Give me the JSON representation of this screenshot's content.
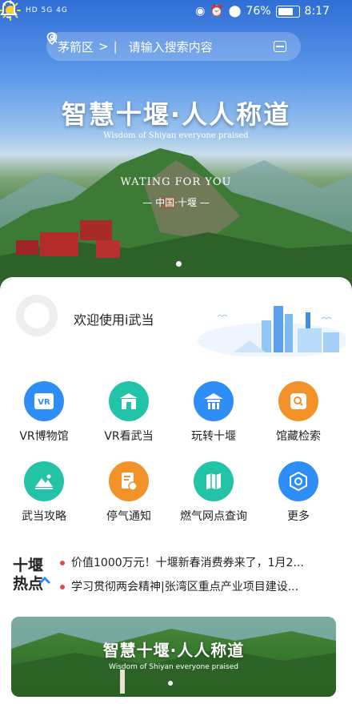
{
  "status": {
    "left": "HD 5G 4G",
    "battery": "76%",
    "time": "8:17"
  },
  "search": {
    "district": "茅箭区",
    "chevron": ">",
    "separator": "|",
    "placeholder": "请输入搜索内容"
  },
  "hero": {
    "title": "智慧十堰·人人称道",
    "subtitle": "Wisdom of Shiyan everyone praised",
    "tagline": "WATING FOR YOU",
    "place": "— 中国·十堰 —"
  },
  "user": {
    "welcome": "欢迎使用i武当"
  },
  "services": [
    {
      "label": "VR博物馆",
      "icon": "vr-icon",
      "color": "#2f8ef5"
    },
    {
      "label": "VR看武当",
      "icon": "temple-icon",
      "color": "#22c3a6"
    },
    {
      "label": "玩转十堰",
      "icon": "pavilion-icon",
      "color": "#2f8ef5"
    },
    {
      "label": "馆藏检索",
      "icon": "search-collection-icon",
      "color": "#f4922a"
    },
    {
      "label": "武当攻略",
      "icon": "mountain-guide-icon",
      "color": "#22c3a6"
    },
    {
      "label": "停气通知",
      "icon": "gas-notice-icon",
      "color": "#f4922a"
    },
    {
      "label": "燃气网点查询",
      "icon": "map-icon",
      "color": "#22c3a6"
    },
    {
      "label": "更多",
      "icon": "more-icon",
      "color": "#2f8ef5"
    }
  ],
  "news": {
    "logo_text": "十堰热点",
    "items": [
      "价值1000万元！十堰新春消费券来了，1月2...",
      "学习贯彻两会精神|张湾区重点产业项目建设..."
    ]
  },
  "banner": {
    "title": "智慧十堰·人人称道",
    "subtitle": "Wisdom of Shiyan everyone praised"
  }
}
